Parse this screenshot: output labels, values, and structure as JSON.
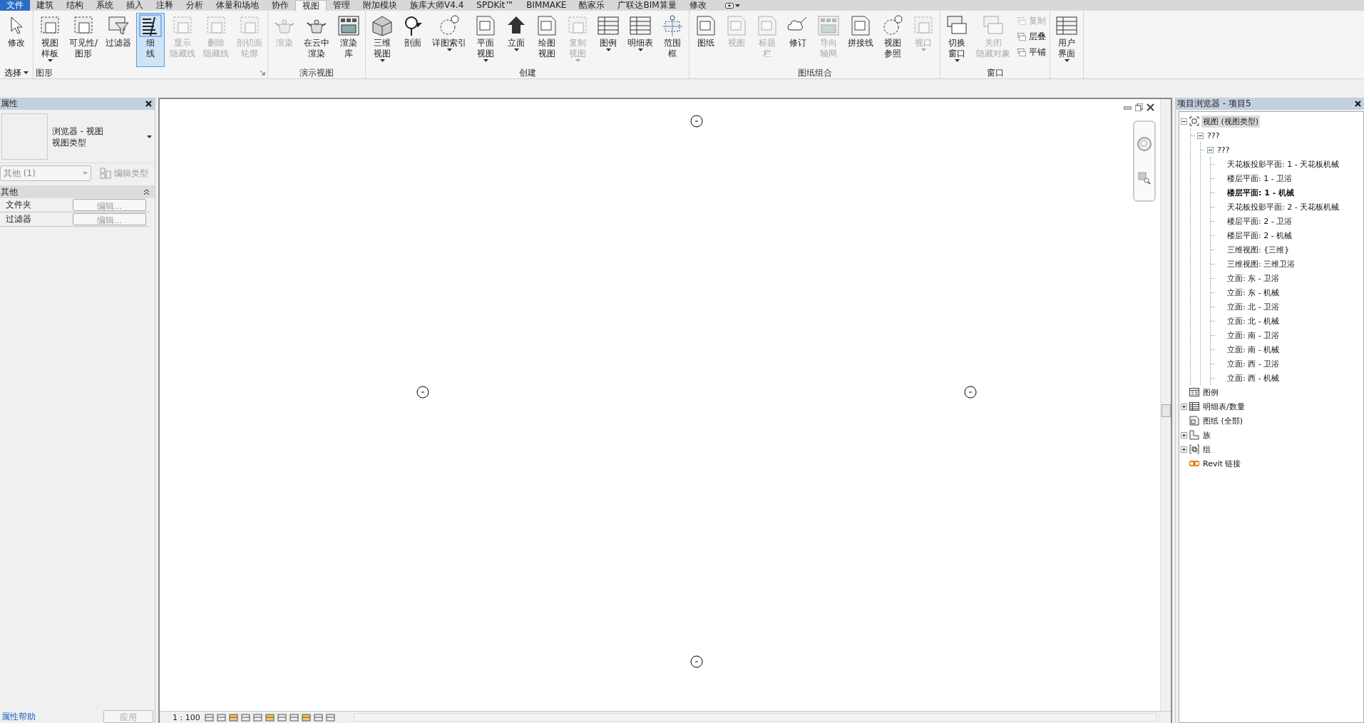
{
  "menu_tabs": [
    {
      "label": "文件",
      "kind": "file",
      "selected": false
    },
    {
      "label": "建筑",
      "kind": "tab",
      "selected": false
    },
    {
      "label": "结构",
      "kind": "tab",
      "selected": false
    },
    {
      "label": "系统",
      "kind": "tab",
      "selected": false
    },
    {
      "label": "插入",
      "kind": "tab",
      "selected": false
    },
    {
      "label": "注释",
      "kind": "tab",
      "selected": false
    },
    {
      "label": "分析",
      "kind": "tab",
      "selected": false
    },
    {
      "label": "体量和场地",
      "kind": "tab",
      "selected": false
    },
    {
      "label": "协作",
      "kind": "tab",
      "selected": false
    },
    {
      "label": "视图",
      "kind": "tab",
      "selected": true
    },
    {
      "label": "管理",
      "kind": "tab",
      "selected": false
    },
    {
      "label": "附加模块",
      "kind": "tab",
      "selected": false
    },
    {
      "label": "族库大师V4.4",
      "kind": "tab",
      "selected": false
    },
    {
      "label": "SPDKit™",
      "kind": "tab",
      "selected": false
    },
    {
      "label": "BIMMAKE",
      "kind": "tab",
      "selected": false
    },
    {
      "label": "酷家乐",
      "kind": "tab",
      "selected": false
    },
    {
      "label": "广联达BIM算量",
      "kind": "tab",
      "selected": false
    },
    {
      "label": "修改",
      "kind": "tab",
      "selected": false
    }
  ],
  "ribbon": {
    "groups": [
      {
        "title": "选择",
        "dropdown": true,
        "buttons": [
          {
            "lines": [
              "修改"
            ],
            "kind": "large",
            "dropdown": false,
            "disabled": false,
            "on": false
          }
        ]
      },
      {
        "title": "图形",
        "launcher": true,
        "buttons": [
          {
            "lines": [
              "视图",
              "样板"
            ],
            "kind": "large",
            "dropdown": true,
            "disabled": false,
            "on": false
          },
          {
            "lines": [
              "可见性/",
              "图形"
            ],
            "kind": "large",
            "dropdown": false,
            "disabled": false,
            "on": false
          },
          {
            "lines": [
              "过滤器"
            ],
            "kind": "large",
            "dropdown": false,
            "disabled": false,
            "on": false
          },
          {
            "lines": [
              "细",
              "线"
            ],
            "kind": "large",
            "dropdown": false,
            "disabled": false,
            "on": true
          },
          {
            "lines": [
              "显示",
              "隐藏线"
            ],
            "kind": "large",
            "dropdown": false,
            "disabled": true,
            "on": false
          },
          {
            "lines": [
              "删除",
              "隐藏线"
            ],
            "kind": "large",
            "dropdown": false,
            "disabled": true,
            "on": false
          },
          {
            "lines": [
              "剖切面",
              "轮廓"
            ],
            "kind": "large",
            "dropdown": false,
            "disabled": true,
            "on": false
          }
        ]
      },
      {
        "title": "演示视图",
        "buttons": [
          {
            "lines": [
              "渲染"
            ],
            "kind": "large",
            "dropdown": false,
            "disabled": true,
            "on": false
          },
          {
            "lines": [
              "在云中",
              "渲染"
            ],
            "kind": "large",
            "dropdown": false,
            "disabled": false,
            "on": false
          },
          {
            "lines": [
              "渲染",
              "库"
            ],
            "kind": "large",
            "dropdown": false,
            "disabled": false,
            "on": false
          }
        ]
      },
      {
        "title": "创建",
        "buttons": [
          {
            "lines": [
              "三维",
              "视图"
            ],
            "kind": "large",
            "dropdown": true,
            "disabled": false,
            "on": false
          },
          {
            "lines": [
              "剖面"
            ],
            "kind": "large",
            "dropdown": false,
            "disabled": false,
            "on": false
          },
          {
            "lines": [
              "详图索引"
            ],
            "kind": "large",
            "dropdown": true,
            "disabled": false,
            "on": false
          },
          {
            "lines": [
              "平面",
              "视图"
            ],
            "kind": "large",
            "dropdown": true,
            "disabled": false,
            "on": false
          },
          {
            "lines": [
              "立面"
            ],
            "kind": "large",
            "dropdown": true,
            "disabled": false,
            "on": false
          },
          {
            "lines": [
              "绘图",
              "视图"
            ],
            "kind": "large",
            "dropdown": false,
            "disabled": false,
            "on": false
          },
          {
            "lines": [
              "复制",
              "视图"
            ],
            "kind": "large",
            "dropdown": true,
            "disabled": true,
            "on": false
          },
          {
            "lines": [
              "图例"
            ],
            "kind": "large",
            "dropdown": true,
            "disabled": false,
            "on": false
          },
          {
            "lines": [
              "明细表"
            ],
            "kind": "large",
            "dropdown": true,
            "disabled": false,
            "on": false
          },
          {
            "lines": [
              "范围",
              "框"
            ],
            "kind": "large",
            "dropdown": false,
            "disabled": false,
            "on": false
          }
        ]
      },
      {
        "title": "图纸组合",
        "buttons": [
          {
            "lines": [
              "图纸"
            ],
            "kind": "large",
            "dropdown": false,
            "disabled": false,
            "on": false
          },
          {
            "lines": [
              "视图"
            ],
            "kind": "large",
            "dropdown": false,
            "disabled": true,
            "on": false
          },
          {
            "lines": [
              "标题",
              "栏"
            ],
            "kind": "large",
            "dropdown": false,
            "disabled": true,
            "on": false
          },
          {
            "lines": [
              "修订"
            ],
            "kind": "large",
            "dropdown": false,
            "disabled": false,
            "on": false
          },
          {
            "lines": [
              "导向",
              "轴网"
            ],
            "kind": "large",
            "dropdown": false,
            "disabled": true,
            "on": false
          },
          {
            "lines": [
              "拼接线"
            ],
            "kind": "large",
            "dropdown": false,
            "disabled": false,
            "on": false
          },
          {
            "lines": [
              "视图",
              "参照"
            ],
            "kind": "large",
            "dropdown": false,
            "disabled": false,
            "on": false
          },
          {
            "lines": [
              "视口"
            ],
            "kind": "large",
            "dropdown": true,
            "disabled": true,
            "on": false
          }
        ]
      },
      {
        "title": "窗口",
        "buttons": [
          {
            "lines": [
              "切换",
              "窗口"
            ],
            "kind": "large",
            "dropdown": true,
            "disabled": false,
            "on": false
          },
          {
            "lines": [
              "关闭",
              "隐藏对象"
            ],
            "kind": "large",
            "dropdown": false,
            "disabled": true,
            "on": false
          },
          {
            "lines": [
              "复制"
            ],
            "kind": "small",
            "dropdown": false,
            "disabled": true,
            "on": false
          },
          {
            "lines": [
              "层叠"
            ],
            "kind": "small",
            "dropdown": false,
            "disabled": false,
            "on": false
          },
          {
            "lines": [
              "平铺"
            ],
            "kind": "small",
            "dropdown": false,
            "disabled": false,
            "on": false
          }
        ]
      },
      {
        "buttons": [
          {
            "lines": [
              "用户",
              "界面"
            ],
            "kind": "large",
            "dropdown": true,
            "disabled": false,
            "on": false
          }
        ]
      }
    ]
  },
  "properties": {
    "title": "属性",
    "type_selector": {
      "name": "浏览器 - 视图",
      "type": "视图类型"
    },
    "filter": "其他 (1)",
    "edit_type": {
      "label": "编辑类型",
      "disabled": true
    },
    "sections": [
      {
        "title": "其他",
        "expanded": true,
        "rows": [
          {
            "name": "文件夹",
            "value": "编辑..."
          },
          {
            "name": "过滤器",
            "value": "编辑..."
          }
        ]
      }
    ],
    "help_link": "属性帮助",
    "apply": {
      "label": "应用",
      "disabled": true
    }
  },
  "view": {
    "scale": "1 : 100"
  },
  "project_browser": {
    "title": "项目浏览器 - 项目5",
    "items": [
      {
        "label": "视图 (视图类型)",
        "expanded": true,
        "selected": true,
        "current": false,
        "children": [
          {
            "label": "???",
            "expanded": true,
            "selected": false,
            "current": false,
            "children": [
              {
                "label": "???",
                "expanded": true,
                "selected": false,
                "current": false,
                "children": [
                  {
                    "label": "天花板投影平面: 1 - 天花板机械",
                    "selected": false,
                    "current": false
                  },
                  {
                    "label": "楼层平面: 1 - 卫浴",
                    "selected": false,
                    "current": false
                  },
                  {
                    "label": "楼层平面: 1 - 机械",
                    "selected": false,
                    "current": true
                  },
                  {
                    "label": "天花板投影平面: 2 - 天花板机械",
                    "selected": false,
                    "current": false
                  },
                  {
                    "label": "楼层平面: 2 - 卫浴",
                    "selected": false,
                    "current": false
                  },
                  {
                    "label": "楼层平面: 2 - 机械",
                    "selected": false,
                    "current": false
                  },
                  {
                    "label": "三维视图: {三维}",
                    "selected": false,
                    "current": false
                  },
                  {
                    "label": "三维视图: 三维卫浴",
                    "selected": false,
                    "current": false
                  },
                  {
                    "label": "立面: 东 - 卫浴",
                    "selected": false,
                    "current": false
                  },
                  {
                    "label": "立面: 东 - 机械",
                    "selected": false,
                    "current": false
                  },
                  {
                    "label": "立面: 北 - 卫浴",
                    "selected": false,
                    "current": false
                  },
                  {
                    "label": "立面: 北 - 机械",
                    "selected": false,
                    "current": false
                  },
                  {
                    "label": "立面: 南 - 卫浴",
                    "selected": false,
                    "current": false
                  },
                  {
                    "label": "立面: 南 - 机械",
                    "selected": false,
                    "current": false
                  },
                  {
                    "label": "立面: 西 - 卫浴",
                    "selected": false,
                    "current": false
                  },
                  {
                    "label": "立面: 西 - 机械",
                    "selected": false,
                    "current": false
                  }
                ]
              }
            ]
          }
        ]
      },
      {
        "label": "图例",
        "selected": false,
        "current": false
      },
      {
        "label": "明细表/数量",
        "expanded": false,
        "selected": false,
        "current": false
      },
      {
        "label": "图纸 (全部)",
        "selected": false,
        "current": false
      },
      {
        "label": "族",
        "expanded": false,
        "selected": false,
        "current": false
      },
      {
        "label": "组",
        "expanded": false,
        "selected": false,
        "current": false
      },
      {
        "label": "Revit 链接",
        "selected": false,
        "current": false
      }
    ]
  }
}
